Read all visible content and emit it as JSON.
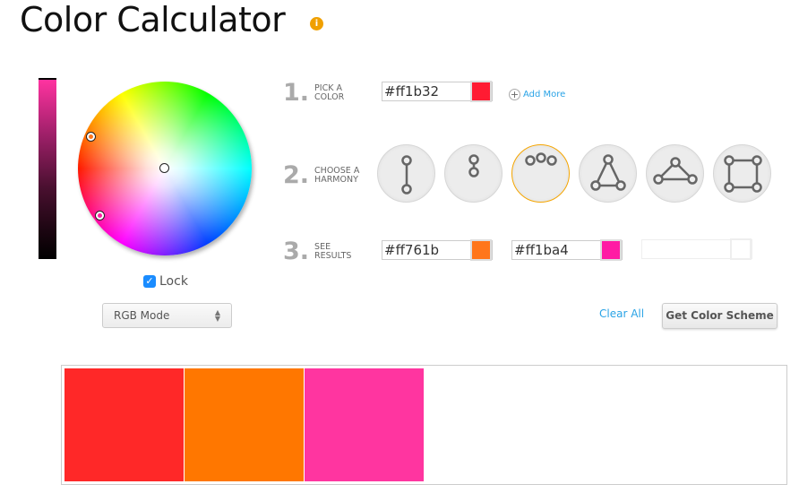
{
  "title": "Color Calculator",
  "info_icon": "info-icon",
  "lock": {
    "label": "Lock",
    "checked": true
  },
  "mode_select": {
    "value": "RGB Mode"
  },
  "steps": [
    {
      "num": "1.",
      "label1": "Pick a",
      "label2": "Color"
    },
    {
      "num": "2.",
      "label1": "Choose a",
      "label2": "Harmony"
    },
    {
      "num": "3.",
      "label1": "See",
      "label2": "Results"
    }
  ],
  "pick": {
    "hex": "#ff1b32",
    "color": "#ff1b32",
    "add_more": "Add More"
  },
  "harmonies": [
    {
      "name": "complementary",
      "selected": false
    },
    {
      "name": "monochromatic",
      "selected": false
    },
    {
      "name": "analogous",
      "selected": true
    },
    {
      "name": "split-complementary",
      "selected": false
    },
    {
      "name": "triadic",
      "selected": false
    },
    {
      "name": "tetradic",
      "selected": false
    }
  ],
  "results": [
    {
      "hex": "#ff761b",
      "color": "#ff761b"
    },
    {
      "hex": "#ff1ba4",
      "color": "#ff1ba4"
    }
  ],
  "clear_all": "Clear All",
  "get_scheme": "Get Color Scheme",
  "palette": [
    "#ff2828",
    "#ff7700",
    "#ff35a0"
  ],
  "accent": "#29a3e6"
}
